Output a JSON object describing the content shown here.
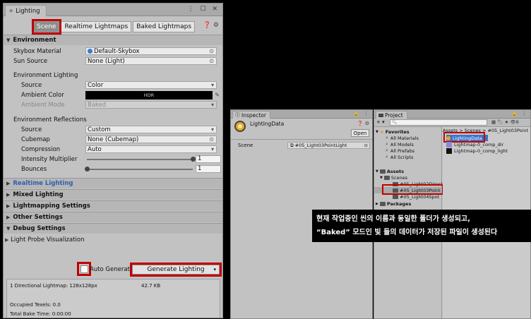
{
  "lighting": {
    "window_title": "Lighting",
    "window_controls": "⋮ ☐ ✕",
    "tabs": [
      "Scene",
      "Realtime Lightmaps",
      "Baked Lightmaps"
    ],
    "help_icons": "❓ ⚙",
    "environment": {
      "header": "Environment",
      "skybox_label": "Skybox Material",
      "skybox_value": "Default-Skybox",
      "sun_label": "Sun Source",
      "sun_value": "None (Light)",
      "env_lighting_header": "Environment Lighting",
      "source_label": "Source",
      "source_value": "Color",
      "ambient_color_label": "Ambient Color",
      "ambient_color_value": "HDR",
      "ambient_mode_label": "Ambient Mode",
      "ambient_mode_value": "Baked",
      "reflections_header": "Environment Reflections",
      "refl_source_label": "Source",
      "refl_source_value": "Custom",
      "cubemap_label": "Cubemap",
      "cubemap_value": "None (Cubemap)",
      "compression_label": "Compression",
      "compression_value": "Auto",
      "intensity_label": "Intensity Multiplier",
      "intensity_value": "1",
      "intensity_fraction": 1.0,
      "bounces_label": "Bounces",
      "bounces_value": "1",
      "bounces_fraction": 0.0
    },
    "sections": {
      "realtime": "Realtime Lighting",
      "mixed": "Mixed Lighting",
      "lightmapping": "Lightmapping Settings",
      "other": "Other Settings",
      "debug": "Debug Settings",
      "light_probe": "Light Probe Visualization"
    },
    "auto_generate_label": "Auto Generate",
    "generate_button": "Generate Lighting",
    "stats": {
      "lightmap": "1 Directional Lightmap: 128x128px",
      "size": "42.7 KB",
      "occupied": "Occupied Texels: 0.0",
      "bake_time": "Total Bake Time: 0:00:00"
    }
  },
  "inspector": {
    "tab": "Inspector",
    "controls": "🔒 ⋮",
    "asset_name": "LightingData",
    "header_icons": "❓ ⚙",
    "open_button": "Open",
    "scene_label": "Scene",
    "scene_value": "#05_Light03PointLight"
  },
  "project": {
    "tab": "Project",
    "controls": "🔒 ⋮",
    "toolbar_add": "+ ▾",
    "search_placeholder": "",
    "toolbar_icons": "▦ 🏷 ★ 👁8",
    "favorites": {
      "header": "Favorites",
      "items": [
        "All Materials",
        "All Models",
        "All Prefabs",
        "All Scripts"
      ]
    },
    "assets": {
      "header": "Assets",
      "scenes": "Scenes",
      "scene_folders": [
        "#05_Light02Direct",
        "#05_Light03Point",
        "#05_Light04Spot"
      ]
    },
    "packages": "Packages",
    "breadcrumb": "Assets > Scenes > #05_Light03Point",
    "files": [
      "LightingData",
      "Lightmap-0_comp_dir",
      "Lightmap-0_comp_light"
    ]
  },
  "annotation": {
    "line1": "현재 작업중인 씬의 이름과 동일한 폴더가 생성되고,",
    "line2": "“Baked” 모드인 빛 들의 데이터가 저장된 파일이 생성된다"
  },
  "colors": {
    "highlight_red": "#c00000",
    "selection_blue": "#3a73c9",
    "section_blue": "#2d5fb0"
  }
}
